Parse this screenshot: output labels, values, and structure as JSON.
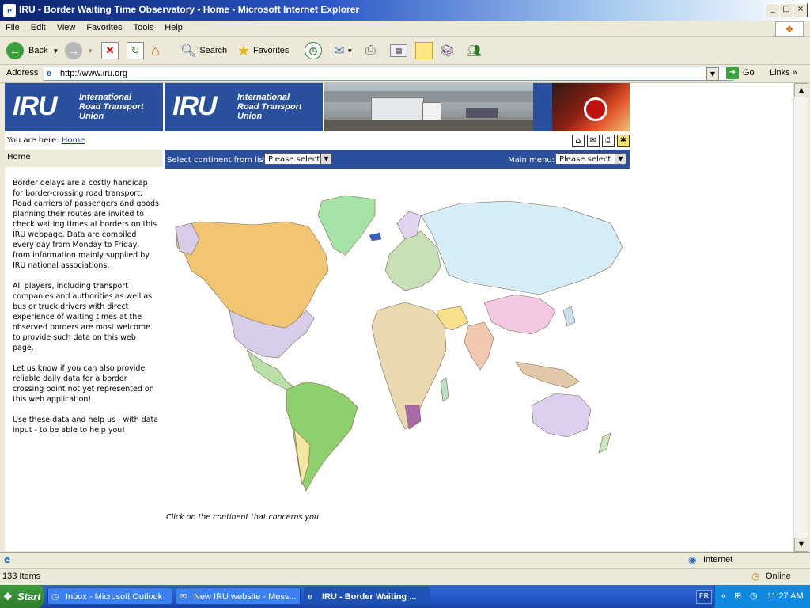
{
  "window": {
    "title": "IRU - Border Waiting Time Observatory - Home - Microsoft Internet Explorer",
    "icon": "ie-icon"
  },
  "menu": [
    "File",
    "Edit",
    "View",
    "Favorites",
    "Tools",
    "Help"
  ],
  "toolbar": {
    "back_label": "Back",
    "search_label": "Search",
    "favorites_label": "Favorites"
  },
  "address": {
    "label": "Address",
    "url": "http://www.iru.org",
    "go_label": "Go",
    "links_label": "Links"
  },
  "site": {
    "logo_text": "IRU",
    "org_line1": "International",
    "org_line2": "Road Transport",
    "org_line3": "Union",
    "breadcrumb_prefix": "You are here:",
    "breadcrumb_link": "Home",
    "nav_home": "Home",
    "continent_label": "Select continent from list:",
    "continent_value": "Please select",
    "main_menu_label": "Main menu:",
    "main_menu_value": "Please select",
    "paragraphs": [
      "Border delays are a costly handicap for border-crossing road transport. Road carriers of passengers and goods planning their routes are invited to check waiting times at borders on this IRU webpage. Data are compiled every day from Monday to Friday, from information mainly supplied by IRU national associations.",
      "All players, including transport companies and authorities as well as bus or truck drivers with direct experience of waiting times at the observed borders are most welcome to provide such data on this web page.",
      "Let us know if you can also provide reliable daily data for a border crossing point not yet represented on this web application!",
      "Use these data and help us - with data input - to be able to help you!"
    ],
    "map_caption": "Click on the continent that concerns you"
  },
  "status": {
    "zone": "Internet",
    "items_count": "133 Items",
    "online": "Online"
  },
  "taskbar": {
    "start": "Start",
    "tasks": [
      "Inbox - Microsoft Outlook",
      "New IRU website - Mess...",
      "IRU - Border Waiting ..."
    ],
    "lang": "FR",
    "clock": "11:27 AM"
  },
  "colors": {
    "site_blue": "#2a4f9c",
    "north_america": "#f2c572",
    "europe_asia": "#d6ecf6",
    "greenland": "#a6e3a6",
    "south_america": "#8ecf6e"
  }
}
